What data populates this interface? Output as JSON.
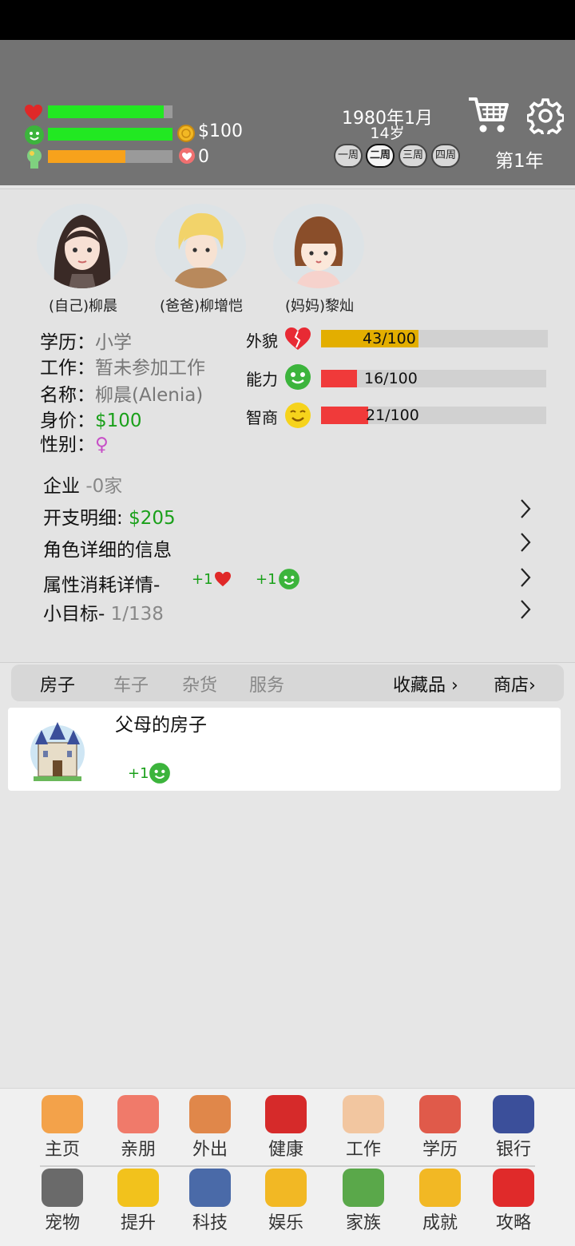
{
  "header": {
    "health_pct": 0.93,
    "happiness_pct": 1.0,
    "stress_pct": 0.62,
    "money": "$100",
    "hearts": "0",
    "date": "1980年1月",
    "age": "14岁",
    "weeks": [
      "一周",
      "二周",
      "三周",
      "四周"
    ],
    "selected_week": 1,
    "year": "第1年",
    "colors": {
      "green": "#22e822",
      "orange": "#f7a21c"
    }
  },
  "family": [
    {
      "label": "(自己)柳晨",
      "avatar": "long-dark-hair-girl-avatar"
    },
    {
      "label": "(爸爸)柳增恺",
      "avatar": "blond-boy-avatar"
    },
    {
      "label": "(妈妈)黎灿",
      "avatar": "bob-hair-girl-avatar"
    }
  ],
  "profile": {
    "education_label": "学历：",
    "education": "小学",
    "work_label": "工作：",
    "work": "暂未参加工作",
    "name_label": "名称：",
    "name": "柳晨(Alenia)",
    "worth_label": "身价：",
    "worth": "$100",
    "gender_label": "性别：",
    "gender_symbol": "♀"
  },
  "attributes": [
    {
      "label": "外貌",
      "value": "43/100",
      "fraction": 0.43,
      "color": "#e3ae00"
    },
    {
      "label": "能力",
      "value": "16/100",
      "fraction": 0.16,
      "color": "#f03a3a"
    },
    {
      "label": "智商",
      "value": "21/100",
      "fraction": 0.21,
      "color": "#f03a3a"
    }
  ],
  "rows": {
    "company_label": "企业",
    "company_value": "-0家",
    "expense_label": "开支明细:",
    "expense_value": "$205",
    "detail_label": "角色详细的信息",
    "consume_label": "属性消耗详情-",
    "consume_a": "+1",
    "consume_b": "+1",
    "goal_label": "小目标-",
    "goal_value": "1/138"
  },
  "tabs": {
    "house": "房子",
    "car": "车子",
    "misc": "杂货",
    "service": "服务",
    "collection": "收藏品",
    "shop": "商店"
  },
  "house_card": {
    "title": "父母的房子",
    "bonus": "+1"
  },
  "nav": [
    {
      "label": "主页",
      "icon": "home-icon"
    },
    {
      "label": "亲朋",
      "icon": "handshake-icon"
    },
    {
      "label": "外出",
      "icon": "tent-icon"
    },
    {
      "label": "健康",
      "icon": "red-cross-icon"
    },
    {
      "label": "工作",
      "icon": "worker-icon"
    },
    {
      "label": "学历",
      "icon": "study-icon"
    },
    {
      "label": "银行",
      "icon": "bank-icon"
    },
    {
      "label": "宠物",
      "icon": "dog-icon"
    },
    {
      "label": "提升",
      "icon": "lightbulb-icon"
    },
    {
      "label": "科技",
      "icon": "scientist-icon"
    },
    {
      "label": "娱乐",
      "icon": "trophy-heart-icon"
    },
    {
      "label": "家族",
      "icon": "family-tree-icon"
    },
    {
      "label": "成就",
      "icon": "trophy-icon"
    },
    {
      "label": "攻略",
      "icon": "tips-icon"
    }
  ]
}
